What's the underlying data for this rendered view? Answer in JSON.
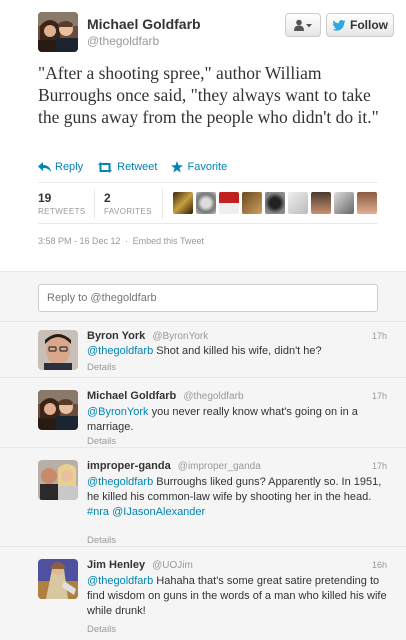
{
  "author": {
    "name": "Michael Goldfarb",
    "handle": "@thegoldfarb"
  },
  "header_buttons": {
    "follow_label": "Follow"
  },
  "tweet": {
    "text": "\"After a shooting spree,\" author William Burroughs once said, \"they always want to take the guns away from the people who didn't do it.\""
  },
  "actions": {
    "reply": "Reply",
    "retweet": "Retweet",
    "favorite": "Favorite"
  },
  "stats": {
    "retweets_count": "19",
    "retweets_label": "RETWEETS",
    "favorites_count": "2",
    "favorites_label": "FAVORITES"
  },
  "meta": {
    "timestamp": "3:58 PM - 16 Dec 12",
    "separator": "·",
    "embed": "Embed this Tweet"
  },
  "reply_box": {
    "placeholder": "Reply to @thegoldfarb"
  },
  "replies": [
    {
      "name": "Byron York",
      "handle": "@ByronYork",
      "time": "17h",
      "mention": "@thegoldfarb",
      "text": " Shot and killed his wife, didn't he?",
      "details": "Details"
    },
    {
      "name": "Michael Goldfarb",
      "handle": "@thegoldfarb",
      "time": "17h",
      "mention": "@ByronYork",
      "text": " you never really know what's going on in a marriage.",
      "details": "Details"
    },
    {
      "name": "improper-ganda",
      "handle": "@improper_ganda",
      "time": "17h",
      "mention": "@thegoldfarb",
      "text": " Burroughs liked guns? Apparently so. In 1951, he killed his common-law wife by shooting her in the head. ",
      "tag1": "#nra",
      "tag2": "@IJasonAlexander",
      "details": "Details"
    },
    {
      "name": "Jim Henley",
      "handle": "@UOJim",
      "time": "16h",
      "mention": "@thegoldfarb",
      "text": " Hahaha that's some great satire pretending to find wisdom on guns in the words of a man who killed his wife while drunk!",
      "details": "Details"
    }
  ],
  "colors": {
    "link": "#0084b4",
    "muted": "#999999",
    "text": "#333333"
  }
}
